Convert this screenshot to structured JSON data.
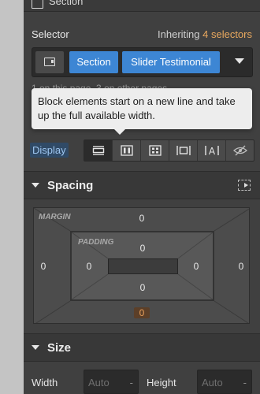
{
  "section": {
    "title": "Section"
  },
  "selector": {
    "label": "Selector",
    "inheriting_prefix": "Inheriting",
    "inheriting_count": "4 selectors",
    "chips": [
      "Section",
      "Slider Testimonial"
    ],
    "hidden_text": "1 on this page, 3 on other pages"
  },
  "tooltip": {
    "text": "Block elements start on a new line and take up the full available width."
  },
  "display": {
    "label": "Display",
    "options": [
      {
        "name": "block",
        "icon": "display-block-icon",
        "active": true
      },
      {
        "name": "flex",
        "icon": "display-flex-icon",
        "active": false
      },
      {
        "name": "grid",
        "icon": "display-grid-icon",
        "active": false
      },
      {
        "name": "inline-block",
        "icon": "display-inline-block-icon",
        "active": false
      },
      {
        "name": "inline",
        "icon": "display-inline-icon",
        "active": false
      },
      {
        "name": "none",
        "icon": "display-none-icon",
        "active": false
      }
    ]
  },
  "spacing": {
    "title": "Spacing",
    "margin_label": "MARGIN",
    "padding_label": "PADDING",
    "margin": {
      "top": "0",
      "right": "0",
      "bottom": "0",
      "left": "0"
    },
    "padding": {
      "top": "0",
      "right": "0",
      "bottom": "0",
      "left": "0"
    }
  },
  "size": {
    "title": "Size",
    "width_label": "Width",
    "height_label": "Height",
    "width_value": "Auto",
    "height_value": "Auto",
    "unit_dash": "-"
  },
  "colors": {
    "accent_blue": "#3d86d4",
    "accent_orange": "#e8a85e",
    "panel": "#404040"
  }
}
